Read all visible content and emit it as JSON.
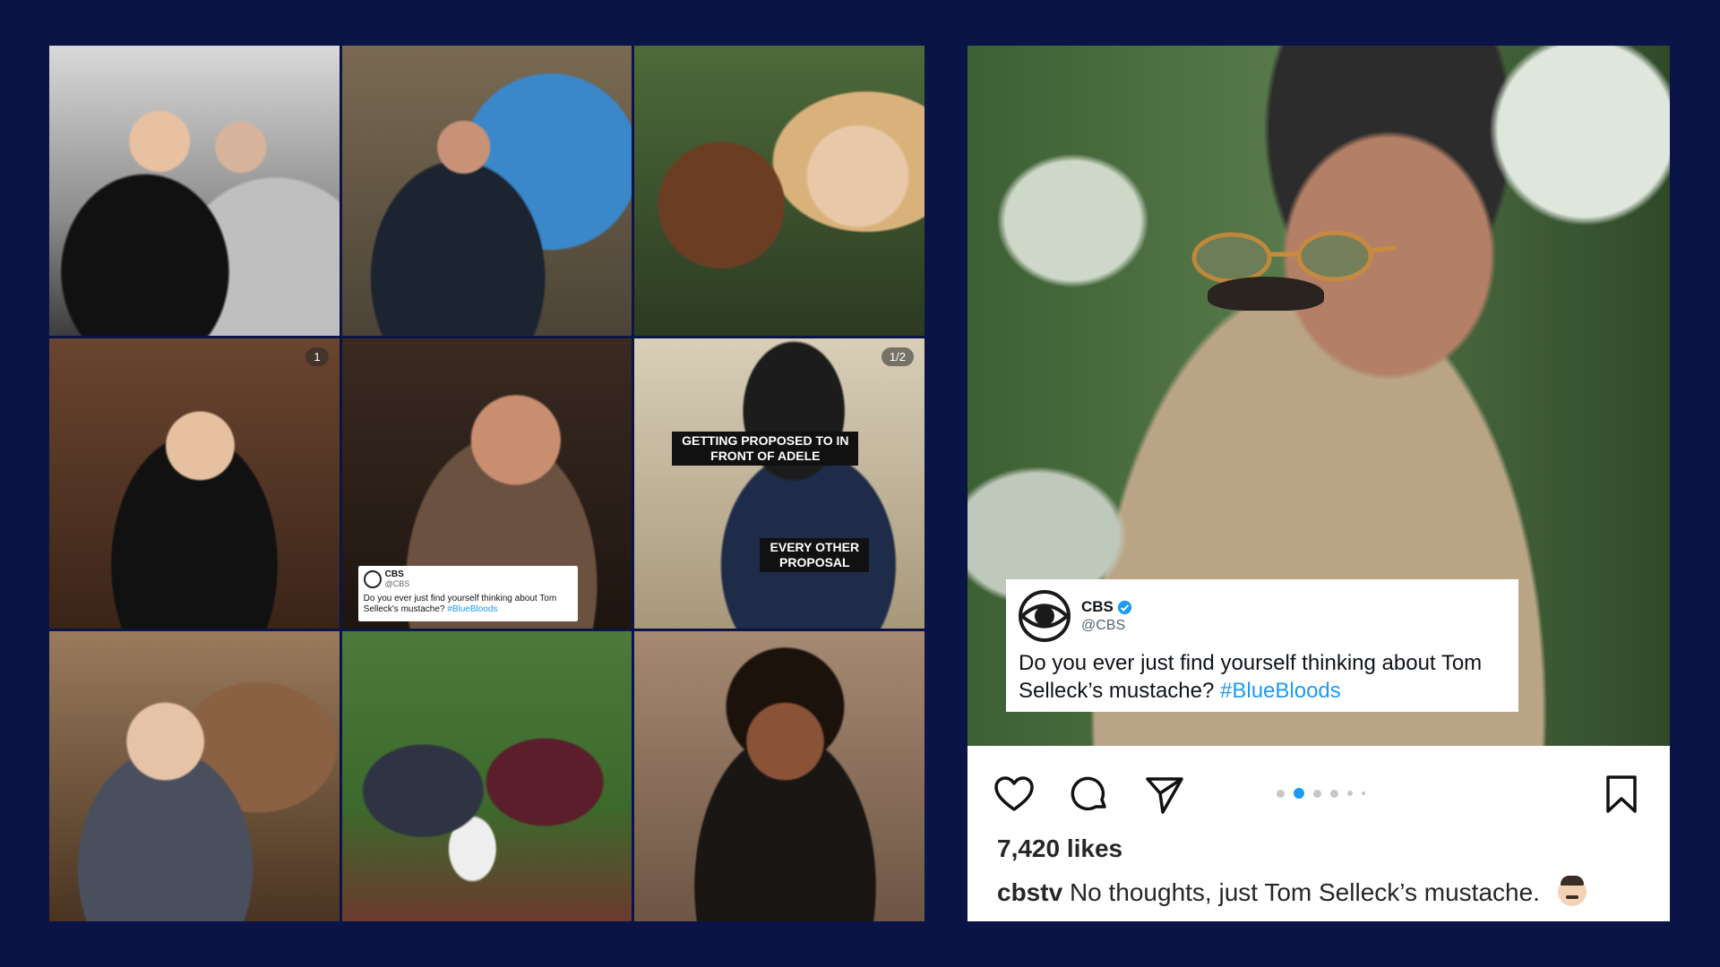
{
  "grid": {
    "tiles": [
      {
        "name": "tile-selfie",
        "badge": ""
      },
      {
        "name": "tile-survivor-host",
        "badge": ""
      },
      {
        "name": "tile-oprah-adele",
        "badge": ""
      },
      {
        "name": "tile-adele-microphone",
        "badge": "1"
      },
      {
        "name": "tile-tom-selleck-tweet",
        "badge": ""
      },
      {
        "name": "tile-proposal-meme",
        "badge": "1/2"
      },
      {
        "name": "tile-young-sheldon",
        "badge": ""
      },
      {
        "name": "tile-holiday-fight",
        "badge": ""
      },
      {
        "name": "tile-yearbook-photo",
        "badge": ""
      }
    ],
    "mini_tweet": {
      "name": "CBS",
      "handle": "@CBS",
      "text": "Do you ever just find yourself thinking about Tom Selleck's mustache?",
      "hashtag": "#BlueBloods"
    },
    "meme": {
      "caption_top": "GETTING PROPOSED TO IN FRONT OF ADELE",
      "caption_bottom": "EVERY OTHER PROPOSAL"
    }
  },
  "post": {
    "tweet": {
      "name": "CBS",
      "handle": "@CBS",
      "text": "Do you ever just find yourself thinking about Tom Selleck’s mustache?",
      "hashtag": "#BlueBloods"
    },
    "actions": {
      "like": "heart-icon",
      "comment": "comment-icon",
      "share": "send-icon",
      "save": "bookmark-icon"
    },
    "carousel": {
      "count": 6,
      "active": 1
    },
    "likes": "7,420 likes",
    "caption_user": "cbstv",
    "caption_text": "No thoughts, just Tom Selleck’s mustache."
  },
  "colors": {
    "background": "#0b1446",
    "accent": "#1d9bf0"
  }
}
